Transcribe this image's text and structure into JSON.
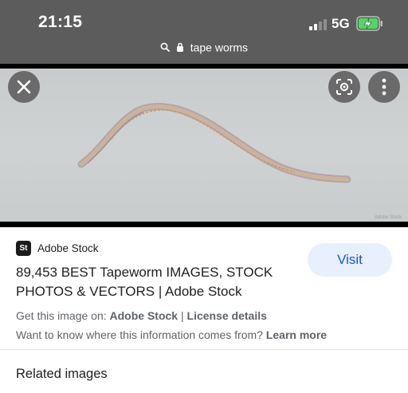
{
  "status_bar": {
    "time": "21:15",
    "network": "5G"
  },
  "url_bar": {
    "text": "tape worms"
  },
  "viewer": {
    "watermark": "Adobe Stock"
  },
  "result": {
    "source_name": "Adobe Stock",
    "source_logo": "St",
    "title": "89,453 BEST Tapeworm IMAGES, STOCK PHOTOS & VECTORS | Adobe Stock",
    "visit_label": "Visit",
    "get_prefix": "Get this image on: ",
    "get_source": "Adobe Stock",
    "separator": " | ",
    "license": "License details",
    "want_text": "Want to know where this information comes from? ",
    "learn_more": "Learn more"
  },
  "related": {
    "heading": "Related images"
  },
  "colors": {
    "topbar": "#5c5c5c",
    "visit_bg": "#e8f0fe",
    "visit_text": "#1a56c4"
  }
}
